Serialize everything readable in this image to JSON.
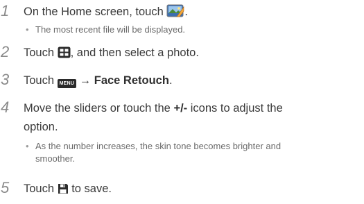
{
  "steps": [
    {
      "number": "1",
      "text_before": "On the Home screen, touch ",
      "icon": "gallery-icon",
      "text_after": ".",
      "sub": "The most recent file will be displayed."
    },
    {
      "number": "2",
      "text_before": "Touch ",
      "icon": "grid-view-icon",
      "text_after": ", and then select a photo."
    },
    {
      "number": "3",
      "text_before": "Touch ",
      "icon": "menu-key-icon",
      "menu_key_label": "MENU",
      "arrow": "→",
      "bold": "Face Retouch",
      "text_after": "."
    },
    {
      "number": "4",
      "text_before": "Move the sliders or touch the ",
      "bold": "+/-",
      "text_mid": " icons to adjust the",
      "text_line2": "option.",
      "sub_line1": "As the number increases, the skin tone becomes brighter and",
      "sub_line2": "smoother."
    },
    {
      "number": "5",
      "text_before": "Touch ",
      "icon": "save-icon",
      "text_after": " to save."
    }
  ],
  "bullet": "•"
}
